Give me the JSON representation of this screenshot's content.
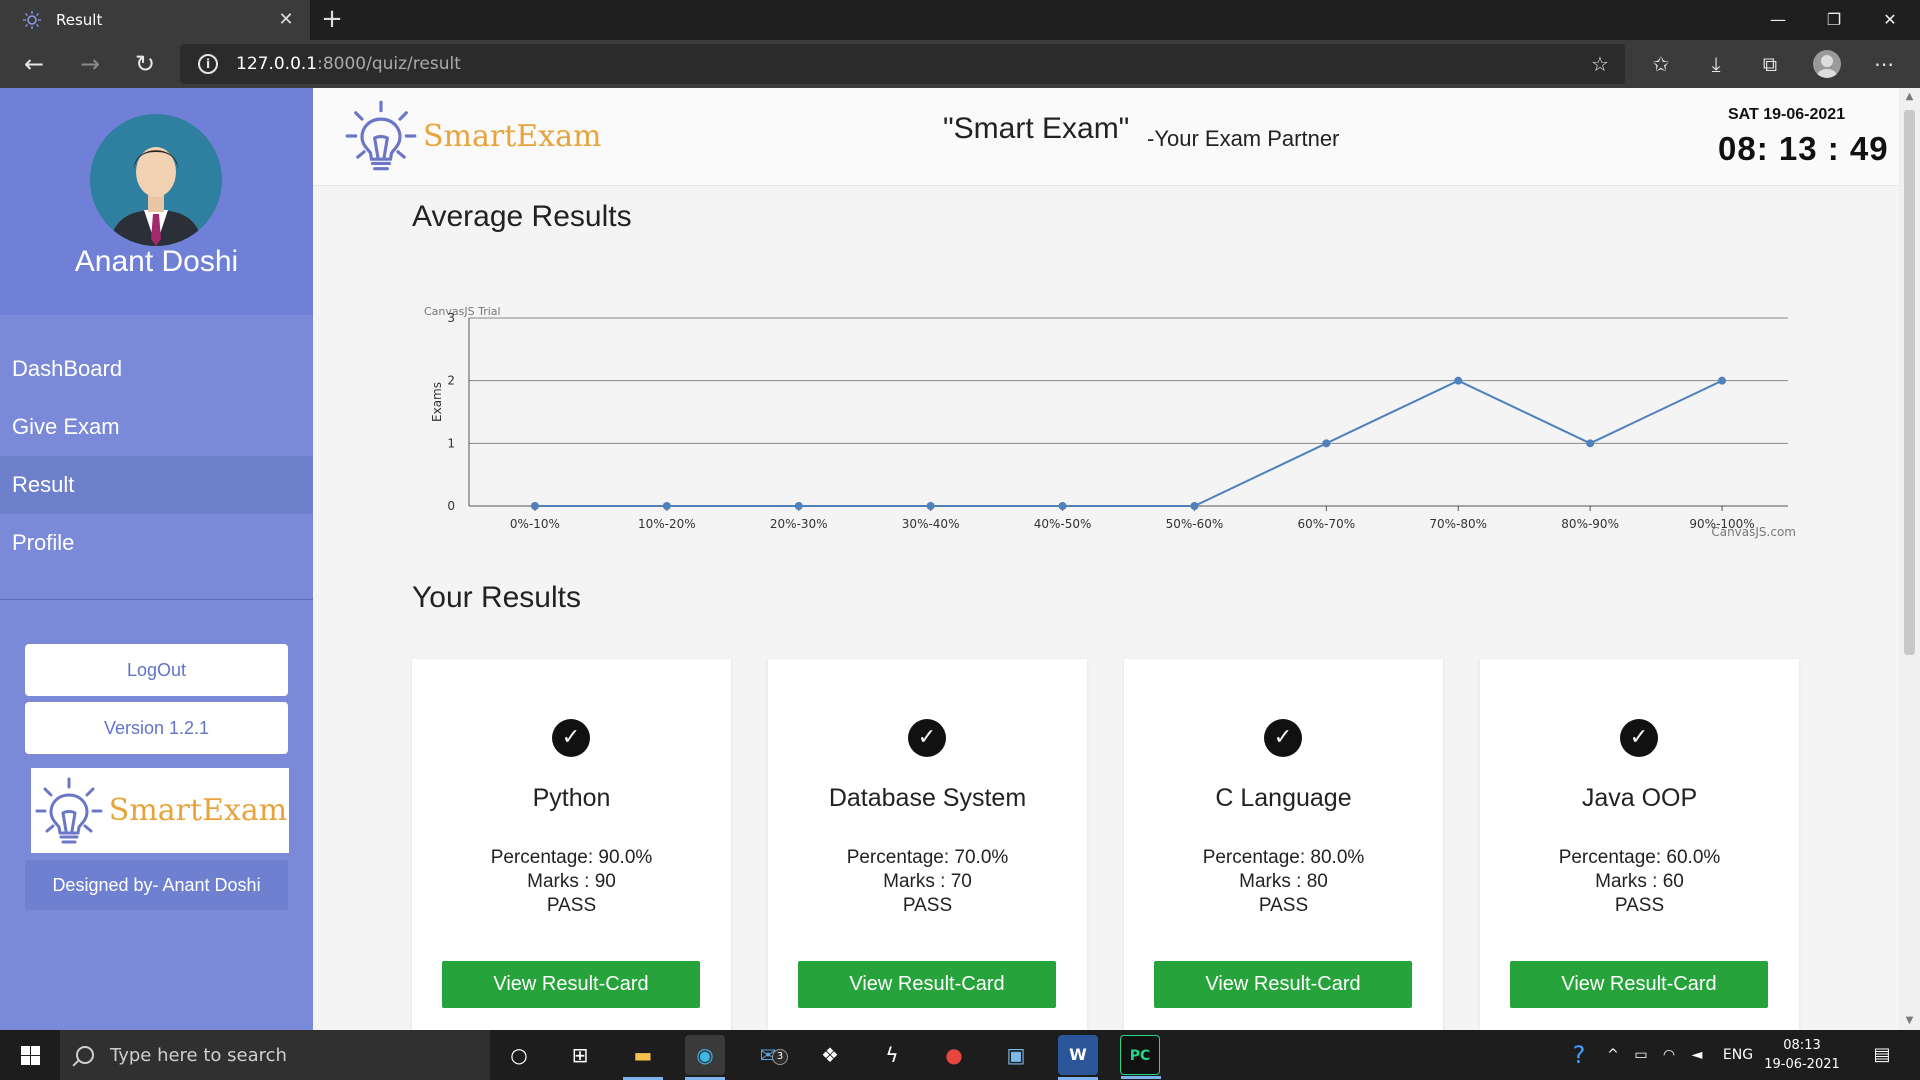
{
  "browser": {
    "tab_title": "Result",
    "url_host": "127.0.0.1",
    "url_path": ":8000/quiz/result"
  },
  "sidebar": {
    "user_name": "Anant Doshi",
    "menu": [
      {
        "label": "DashBoard",
        "active": false
      },
      {
        "label": "Give Exam",
        "active": false
      },
      {
        "label": "Result",
        "active": true
      },
      {
        "label": "Profile",
        "active": false
      }
    ],
    "logout_label": "LogOut",
    "version_label": "Version 1.2.1",
    "logo_text": "SmartExam",
    "designed_by": "Designed by- Anant Doshi"
  },
  "header": {
    "logo_text": "SmartExam",
    "title": "\"Smart Exam\"",
    "subtitle": "-Your Exam Partner",
    "date": "SAT 19-06-2021",
    "clock": "08: 13 : 49"
  },
  "average_section_title": "Average Results",
  "results_section_title": "Your Results",
  "chart_data": {
    "type": "line",
    "title": "",
    "xlabel": "",
    "ylabel": "Exams",
    "categories": [
      "0%-10%",
      "10%-20%",
      "20%-30%",
      "30%-40%",
      "40%-50%",
      "50%-60%",
      "60%-70%",
      "70%-80%",
      "80%-90%",
      "90%-100%"
    ],
    "values": [
      0,
      0,
      0,
      0,
      0,
      0,
      1,
      2,
      1,
      2
    ],
    "ylim": [
      0,
      3
    ],
    "yticks": [
      0,
      1,
      2,
      3
    ],
    "grid": true,
    "watermark_top": "CanvasJS Trial",
    "watermark_bottom": "CanvasJS.com",
    "line_color": "#4f81bc"
  },
  "results": [
    {
      "subject": "Python",
      "percentage": "Percentage: 90.0%",
      "marks": "Marks : 90",
      "status": "PASS",
      "button": "View Result-Card"
    },
    {
      "subject": "Database System",
      "percentage": "Percentage: 70.0%",
      "marks": "Marks : 70",
      "status": "PASS",
      "button": "View Result-Card"
    },
    {
      "subject": "C Language",
      "percentage": "Percentage: 80.0%",
      "marks": "Marks : 80",
      "status": "PASS",
      "button": "View Result-Card"
    },
    {
      "subject": "Java OOP",
      "percentage": "Percentage: 60.0%",
      "marks": "Marks : 60",
      "status": "PASS",
      "button": "View Result-Card"
    }
  ],
  "taskbar": {
    "search_placeholder": "Type here to search",
    "mail_badge": "3",
    "language": "ENG",
    "time": "08:13",
    "date": "19-06-2021"
  },
  "colors": {
    "sidebar": "#7a8ad8",
    "accent_green": "#27a33c",
    "logo_orange": "#e8a33a"
  }
}
